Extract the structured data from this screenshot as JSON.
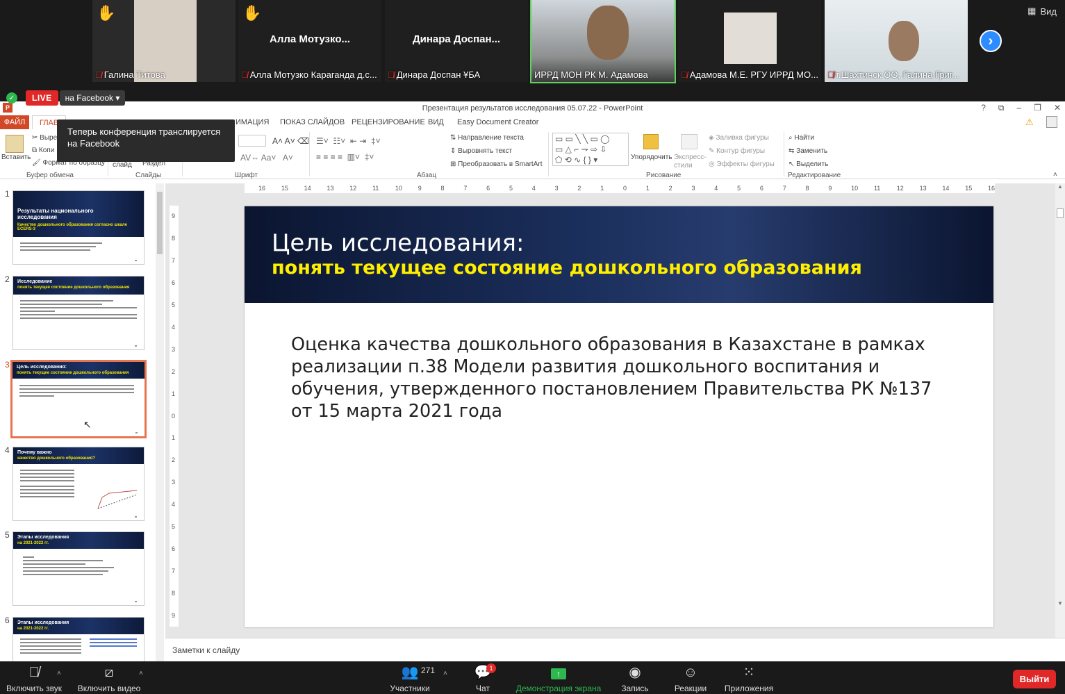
{
  "zoom": {
    "view_label": "Вид",
    "participants": [
      {
        "caption": "Галина Титова",
        "center_name": "",
        "muted": true,
        "hand": true
      },
      {
        "caption": "Алла Мотузко Караганда д.с...",
        "center_name": "Алла  Мотузко...",
        "muted": true,
        "hand": true
      },
      {
        "caption": "Динара Доспан ҰБА",
        "center_name": "Динара  Доспан...",
        "muted": true,
        "hand": false
      },
      {
        "caption": "ИРРД МОН РК М. Адамова",
        "center_name": "",
        "muted": false,
        "hand": false
      },
      {
        "caption": "Адамова М.Е. РГУ ИРРД МО...",
        "center_name": "",
        "muted": true,
        "hand": false
      },
      {
        "caption": "г.Шахтинск ОО, Галина Григ...",
        "center_name": "",
        "muted": true,
        "hand": false
      }
    ],
    "live_badge": "LIVE",
    "live_target": "на Facebook",
    "tooltip": "Теперь конференция транслируется на Facebook",
    "toolbar": {
      "audio": "Включить звук",
      "video": "Включить видео",
      "participants": "Участники",
      "participants_count": "271",
      "chat": "Чат",
      "chat_badge": "1",
      "share": "Демонстрация экрана",
      "record": "Запись",
      "reactions": "Реакции",
      "apps": "Приложения",
      "leave": "Выйти"
    }
  },
  "ppt": {
    "window_title": "Презентация результатов исследования 05.07.22 - PowerPoint",
    "tabs": [
      "ФАЙЛ",
      "ГЛАВ",
      "ИМАЦИЯ",
      "ПОКАЗ СЛАЙДОВ",
      "РЕЦЕНЗИРОВАНИЕ",
      "ВИД",
      "Easy Document Creator"
    ],
    "ribbon": {
      "paste": "Вставить",
      "cut": "Выре",
      "copy": "Копи",
      "format_painter": "Формат по образцу",
      "clipboard": "Буфер обмена",
      "slides": "Слайды",
      "slide_btn": "слайд",
      "section_btn": "Раздел",
      "font": "Шрифт",
      "paragraph": "Абзац",
      "text_direction": "Направление текста",
      "align_text": "Выровнять текст",
      "smartart": "Преобразовать в SmartArt",
      "arrange": "Упорядочить",
      "quick_styles": "Экспресс-стили",
      "shape_fill": "Заливка фигуры",
      "shape_outline": "Контур фигуры",
      "shape_effects": "Эффекты фигуры",
      "drawing": "Рисование",
      "find": "Найти",
      "replace": "Заменить",
      "select": "Выделить",
      "editing": "Редактирование"
    },
    "ruler_h": [
      "16",
      "15",
      "14",
      "13",
      "12",
      "11",
      "10",
      "9",
      "8",
      "7",
      "6",
      "5",
      "4",
      "3",
      "2",
      "1",
      "0",
      "1",
      "2",
      "3",
      "4",
      "5",
      "6",
      "7",
      "8",
      "9",
      "10",
      "11",
      "12",
      "13",
      "14",
      "15",
      "16"
    ],
    "ruler_v": [
      "9",
      "8",
      "7",
      "6",
      "5",
      "4",
      "3",
      "2",
      "1",
      "0",
      "1",
      "2",
      "3",
      "4",
      "5",
      "6",
      "7",
      "8",
      "9"
    ],
    "thumbnails": [
      {
        "num": "1",
        "title": "Результаты национального исследования",
        "sub": "Качество дошкольного образования согласно шкале ECERS-3"
      },
      {
        "num": "2",
        "title": "Исследование",
        "sub": "понять текущее состояние дошкольного образования"
      },
      {
        "num": "3",
        "title": "Цель исследования:",
        "sub": "понять текущее состояние дошкольного образования"
      },
      {
        "num": "4",
        "title": "Почему важно",
        "sub": "качество дошкольного образования?"
      },
      {
        "num": "5",
        "title": "Этапы исследования",
        "sub": "на 2021-2022 гг."
      },
      {
        "num": "6",
        "title": "Этапы исследования",
        "sub": "на 2021-2022 гг."
      }
    ],
    "slide": {
      "title": "Цель исследования:",
      "subtitle": "понять текущее состояние дошкольного образования",
      "body": "Оценка качества дошкольного образования в Казахстане в рамках реализации п.38 Модели развития дошкольного воспитания и обучения, утвержденного постановлением Правительства РК №137 от 15 марта 2021 года",
      "number": "3"
    },
    "notes_label": "Заметки к слайду"
  },
  "colors": {
    "ppt_accent": "#d24726",
    "slide_subtitle": "#ffee00",
    "live_red": "#e02828",
    "share_green": "#2eb84f",
    "zoom_blue": "#2d8cff"
  }
}
